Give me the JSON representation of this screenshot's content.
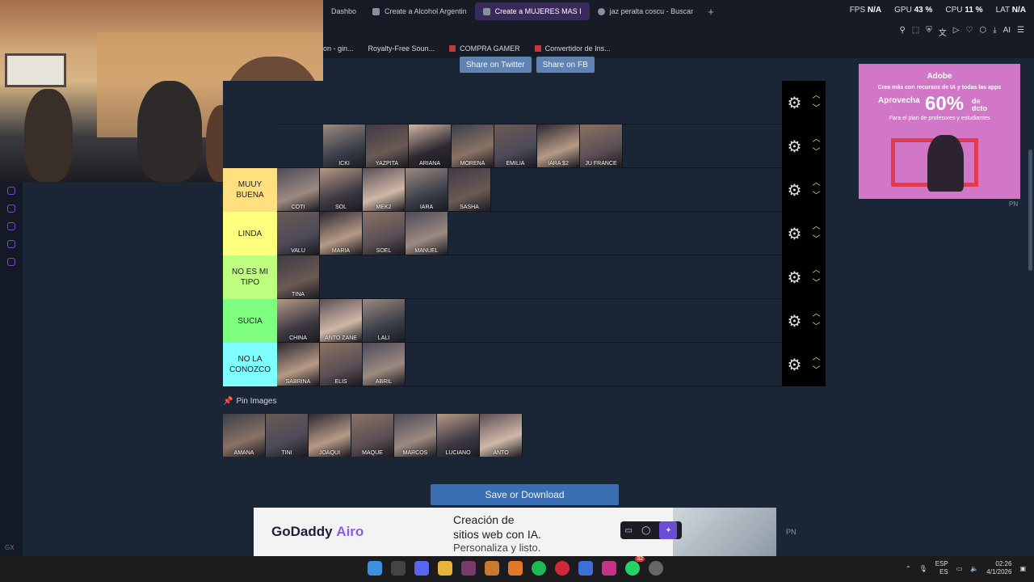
{
  "browser": {
    "tabs": [
      {
        "label": "Dashbo",
        "active": false
      },
      {
        "label": "Create a Alcohol Argentin",
        "active": false
      },
      {
        "label": "Create a MUJERES MAS I",
        "active": true
      },
      {
        "label": "jaz peralta coscu - Buscar",
        "active": false
      }
    ],
    "new_tab": "+",
    "stats": {
      "fps_label": "FPS",
      "fps_value": "N/A",
      "gpu_label": "GPU",
      "gpu_value": "43 %",
      "cpu_label": "CPU",
      "cpu_value": "11 %",
      "lat_label": "LAT",
      "lat_value": "N/A"
    },
    "ai_label": "AI",
    "bookmarks": [
      "on - gin...",
      "Royalty-Free Soun...",
      "COMPRA GAMER",
      "Convertidor de Ins..."
    ]
  },
  "share": {
    "twitter": "Share on Twitter",
    "fb": "Share on FB"
  },
  "tiers": [
    {
      "label": "",
      "color": "#1a2535",
      "items": []
    },
    {
      "label": "",
      "color": "#1a2535",
      "items": [
        "ICKI",
        "YAZPITA",
        "ARIANA",
        "MORENA",
        "EMILIA",
        "IARA $2",
        "JU FRANCE"
      ]
    },
    {
      "label": "MUUY BUENA",
      "color": "#ffdf80",
      "items": [
        "COTI",
        "SOL",
        "MEK2",
        "IARA",
        "SASHA"
      ]
    },
    {
      "label": "LINDA",
      "color": "#ffff7f",
      "items": [
        "VALU",
        "MARIA",
        "SOEL",
        "MANUEL"
      ]
    },
    {
      "label": "NO ES MI TIPO",
      "color": "#bfff7f",
      "items": [
        "TINA"
      ]
    },
    {
      "label": "SUCIA",
      "color": "#7fff7f",
      "items": [
        "CHINA",
        "ANTO ZANE",
        "LALI"
      ]
    },
    {
      "label": "NO LA CONOZCO",
      "color": "#7fffff",
      "items": [
        "SABRINA",
        "ELIS",
        "ABRIL"
      ]
    }
  ],
  "pin": {
    "label": "Pin Images",
    "items": [
      "AMANA",
      "TINI",
      "JOAQUI",
      "MAQUE",
      "MARCOS",
      "LUCIANO",
      "ANTO"
    ]
  },
  "save_label": "Save or Download",
  "ad_right": {
    "brand": "Adobe",
    "line1": "Crea más con recursos de IA y todas las apps",
    "line2": "Aprovecha",
    "percent": "60%",
    "de": "de",
    "dcto": "dcto",
    "line3": "Para el plan de profesores y estudiantes"
  },
  "pn": "PN",
  "ad_bottom": {
    "brand": "GoDaddy",
    "brand2": "Airo",
    "l1": "Creación de",
    "l2": "sitios web con IA.",
    "l3": "Personaliza y listo."
  },
  "taskbar": {
    "lang1": "ESP",
    "lang2": "ES",
    "time": "02:26",
    "date": "4/1/2026",
    "badge": "32"
  },
  "sidebar_bottom": "GX"
}
